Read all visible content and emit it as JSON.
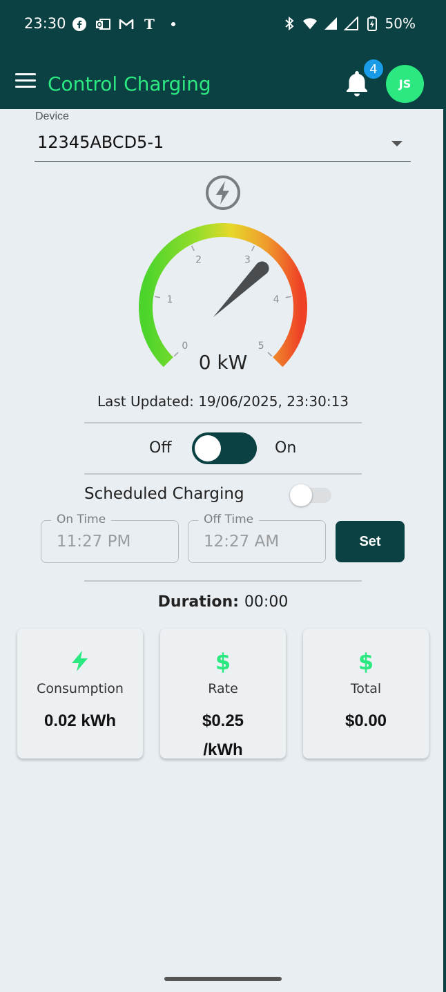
{
  "status_bar": {
    "time": "23:30",
    "battery": "50%",
    "left_icons": [
      "facebook-icon",
      "outlook-icon",
      "gmail-icon",
      "nytimes-icon",
      "dot-icon"
    ],
    "right_icons": [
      "bluetooth-icon",
      "wifi-icon",
      "signal-icon",
      "signal-icon",
      "battery-icon"
    ]
  },
  "app_bar": {
    "title": "Control Charging",
    "notification_count": "4",
    "avatar_initials": "JS"
  },
  "device": {
    "label": "Device",
    "value": "12345ABCD5-1"
  },
  "gauge": {
    "min": 0,
    "max": 5,
    "value": 0,
    "ticks": [
      "0",
      "1",
      "2",
      "3",
      "4",
      "5"
    ],
    "readout": "0 kW"
  },
  "last_updated": "Last Updated: 19/06/2025, 23:30:13",
  "charging_switch": {
    "off_label": "Off",
    "on_label": "On",
    "state": "on"
  },
  "scheduled": {
    "label": "Scheduled Charging",
    "enabled": false,
    "on_time_label": "On Time",
    "on_time_value": "11:27 PM",
    "off_time_label": "Off Time",
    "off_time_value": "12:27 AM",
    "set_label": "Set"
  },
  "duration": {
    "label": "Duration:",
    "value": "00:00"
  },
  "cards": [
    {
      "icon": "bolt-icon",
      "label": "Consumption",
      "value": "0.02 kWh"
    },
    {
      "icon": "dollar-icon",
      "label": "Rate",
      "value": "$0.25 /kWh"
    },
    {
      "icon": "dollar-icon",
      "label": "Total",
      "value": "$0.00"
    }
  ],
  "colors": {
    "primary_dark": "#0b4142",
    "accent_green": "#2ce880",
    "badge_blue": "#1a9be8",
    "background": "#e9eef2"
  }
}
